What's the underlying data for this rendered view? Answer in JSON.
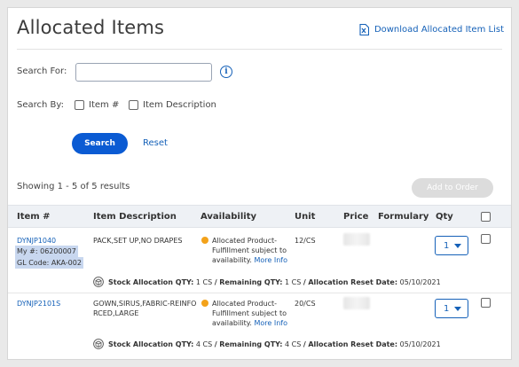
{
  "page": {
    "title": "Allocated Items",
    "download_label": "Download Allocated Item List"
  },
  "search": {
    "for_label": "Search For:",
    "value": "",
    "placeholder": "",
    "by_label": "Search By:",
    "options": [
      "Item #",
      "Item Description"
    ],
    "search_button": "Search",
    "reset_label": "Reset",
    "info_icon": "info-icon"
  },
  "results": {
    "summary": "Showing 1 - 5 of 5 results",
    "add_to_order": "Add to Order"
  },
  "table": {
    "headers": {
      "item": "Item #",
      "description": "Item Description",
      "availability": "Availability",
      "unit": "Unit",
      "price": "Price",
      "formulary": "Formulary",
      "qty": "Qty"
    },
    "rows": [
      {
        "item": "DYNJP1040",
        "my_num": "My #: 06200007",
        "gl_code": "GL Code: AKA-002",
        "description": "PACK,SET UP,NO DRAPES",
        "availability": "Allocated Product-",
        "availability_2": "Fulfillment subject to",
        "availability_3": "availability.",
        "more_info": "More Info",
        "unit": "12/CS",
        "qty": "1",
        "stock": {
          "alloc_label": "Stock Allocation QTY:",
          "alloc_value": "1 CS",
          "sep": "/",
          "remaining_label": "Remaining QTY:",
          "remaining_value": "1 CS",
          "sep2": "/",
          "reset_label": "Allocation Reset Date:",
          "reset_value": "05/10/2021"
        }
      },
      {
        "item": "DYNJP2101S",
        "description": "GOWN,SIRUS,FABRIC-REINFO",
        "description_2": "RCED,LARGE",
        "availability": "Allocated Product-",
        "availability_2": "Fulfillment subject to",
        "availability_3": "availability.",
        "more_info": "More Info",
        "unit": "20/CS",
        "qty": "1",
        "stock": {
          "alloc_label": "Stock Allocation QTY:",
          "alloc_value": "4 CS",
          "sep": "/",
          "remaining_label": "Remaining QTY:",
          "remaining_value": "4 CS",
          "sep2": "/",
          "reset_label": "Allocation Reset Date:",
          "reset_value": "05/10/2021"
        }
      }
    ]
  },
  "colors": {
    "link": "#1561b8",
    "primary_button": "#0b5bd3",
    "availability_dot": "#f3a21a",
    "highlight": "#c8d7ef"
  }
}
